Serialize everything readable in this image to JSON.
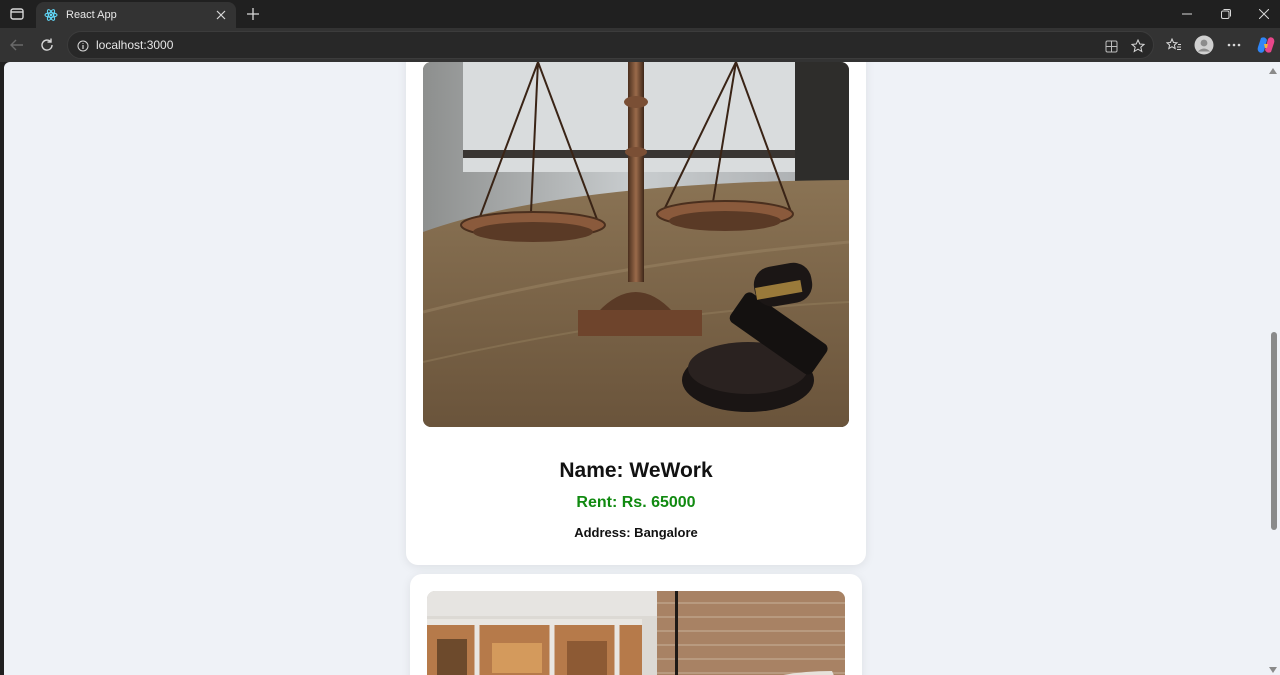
{
  "browser": {
    "tab_title": "React App",
    "url": "localhost:3000"
  },
  "listings": [
    {
      "name": "Name: WeWork",
      "rent": "Rent: Rs. 65000",
      "address": "Address: Bangalore",
      "image_subject": "scales of justice and gavel on wooden table"
    },
    {
      "image_subject": "office interior with brick wall"
    }
  ],
  "colors": {
    "page_bg": "#eff2f7",
    "rent_green": "#118a11",
    "card_bg": "#ffffff"
  },
  "icons": [
    "sidebar-toggle-icon",
    "react-logo-icon",
    "close-icon",
    "plus-icon",
    "minimize-icon",
    "restore-icon",
    "back-icon",
    "reload-icon",
    "info-icon",
    "app-available-icon",
    "star-icon",
    "favorites-icon",
    "profile-icon",
    "more-icon",
    "copilot-icon"
  ]
}
